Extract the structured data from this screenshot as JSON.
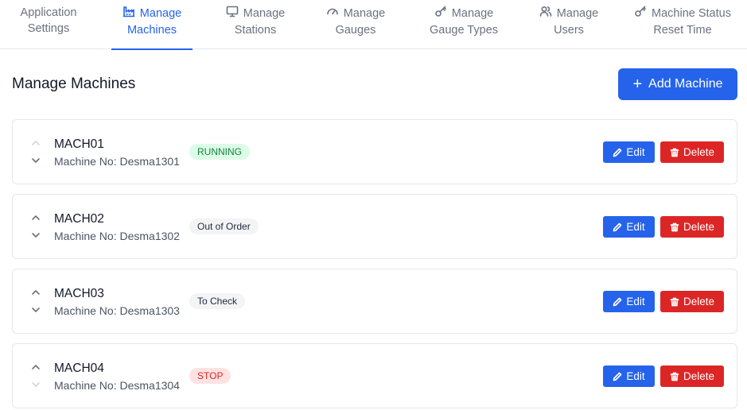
{
  "tabs": [
    {
      "line1": "Application",
      "line2": "Settings",
      "icon": "none"
    },
    {
      "line1": "Manage",
      "line2": "Machines",
      "icon": "factory-icon"
    },
    {
      "line1": "Manage",
      "line2": "Stations",
      "icon": "monitor-icon"
    },
    {
      "line1": "Manage",
      "line2": "Gauges",
      "icon": "gauge-icon"
    },
    {
      "line1": "Manage",
      "line2": "Gauge Types",
      "icon": "key-icon"
    },
    {
      "line1": "Manage",
      "line2": "Users",
      "icon": "users-icon"
    },
    {
      "line1": "Machine Status",
      "line2": "Reset Time",
      "icon": "key-icon"
    }
  ],
  "active_tab": "Manage Machines",
  "header": {
    "title": "Manage Machines",
    "add_button": "Add Machine"
  },
  "machines": [
    {
      "name": "MACH01",
      "number": "Machine No: Desma1301",
      "status": "RUNNING",
      "status_color": "#15803d",
      "up_enabled": false,
      "down_enabled": true
    },
    {
      "name": "MACH02",
      "number": "Machine No: Desma1302",
      "status": "Out of Order",
      "status_color": "#1f2937",
      "up_enabled": true,
      "down_enabled": true
    },
    {
      "name": "MACH03",
      "number": "Machine No: Desma1303",
      "status": "To Check",
      "status_color": "#1f2937",
      "up_enabled": true,
      "down_enabled": true
    },
    {
      "name": "MACH04",
      "number": "Machine No: Desma1304",
      "status": "STOP",
      "status_color": "#dc2626",
      "up_enabled": true,
      "down_enabled": false
    }
  ],
  "actions": {
    "edit": "Edit",
    "delete": "Delete"
  },
  "colors": {
    "primary": "#2563eb",
    "danger": "#dc2626"
  }
}
